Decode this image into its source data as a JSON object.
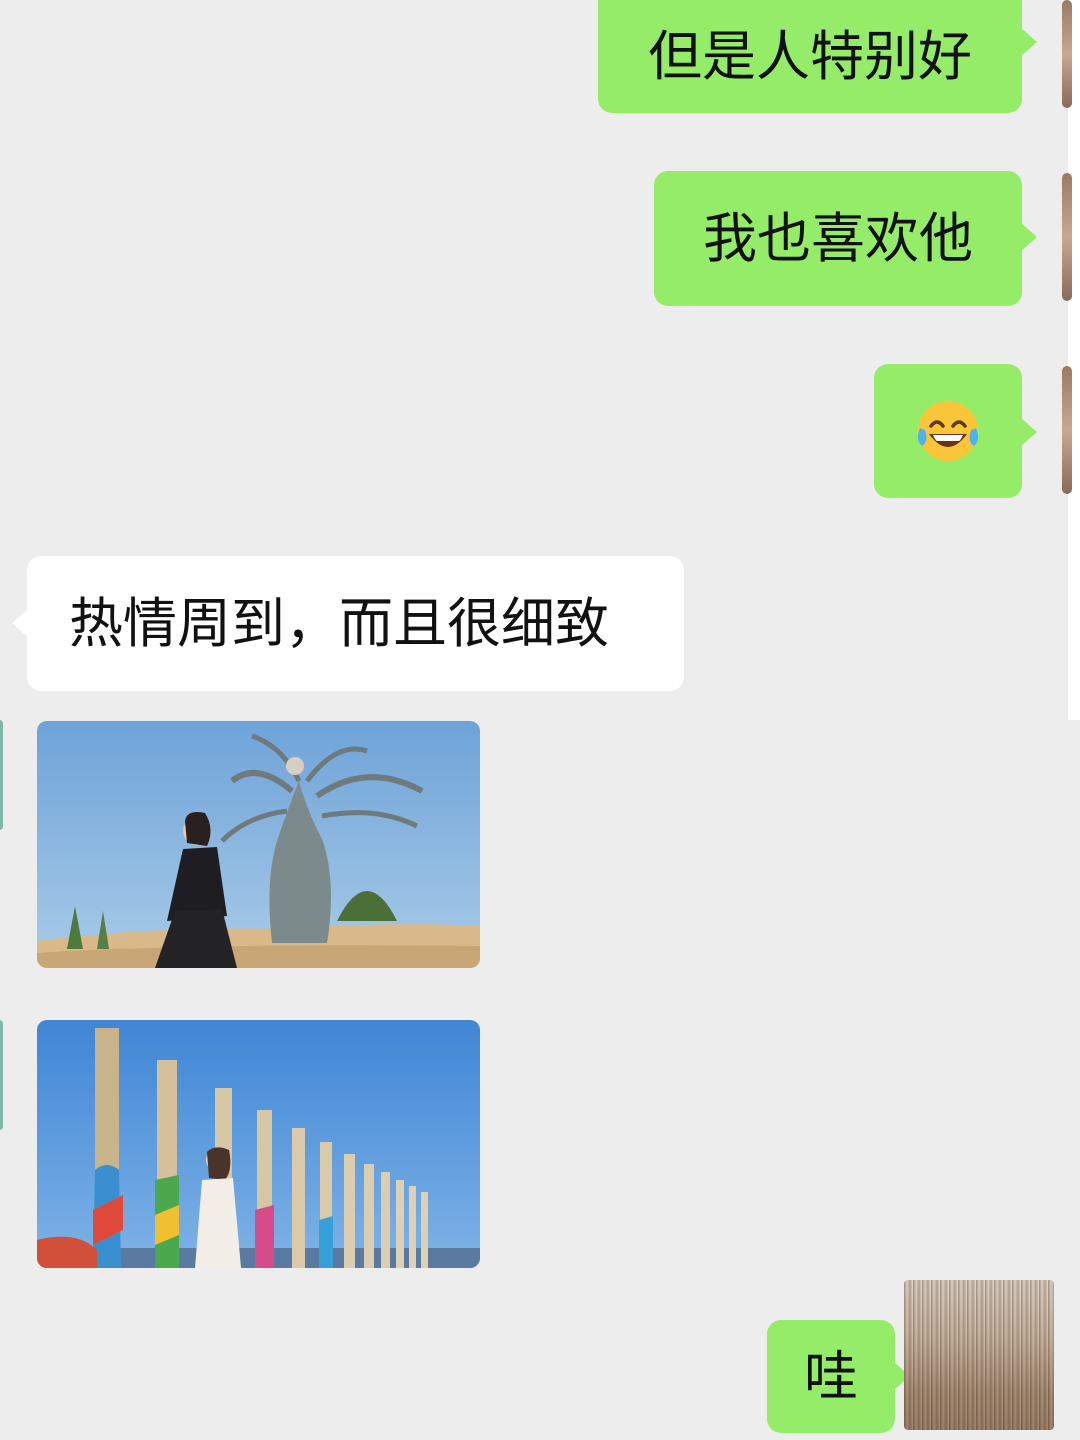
{
  "messages": [
    {
      "type": "text",
      "from": "me",
      "text": "但是人特别好"
    },
    {
      "type": "text",
      "from": "me",
      "text": "我也喜欢他"
    },
    {
      "type": "emoji",
      "from": "me",
      "emoji": "laughing-tears"
    },
    {
      "type": "text",
      "from": "other",
      "text": "热情周到，而且很细致"
    },
    {
      "type": "image",
      "from": "other",
      "description": "woman-with-tree-sculpture"
    },
    {
      "type": "image",
      "from": "other",
      "description": "woman-with-ceremonial-pillars"
    },
    {
      "type": "text",
      "from": "me",
      "text": "哇"
    }
  ],
  "colors": {
    "background": "#ededed",
    "sent_bubble": "#95ec69",
    "received_bubble": "#ffffff"
  }
}
